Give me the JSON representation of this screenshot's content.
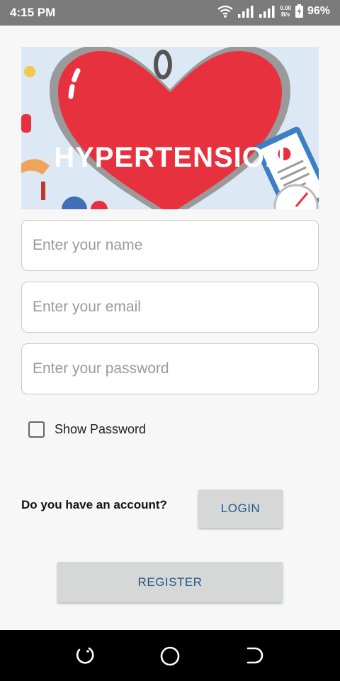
{
  "status_bar": {
    "time": "4:15 PM",
    "net_speed_value": "0.00",
    "net_speed_unit": "B/s",
    "battery": "96%"
  },
  "banner": {
    "title": "HYPERTENSION"
  },
  "form": {
    "name_placeholder": "Enter your name",
    "email_placeholder": "Enter your email",
    "password_placeholder": "Enter your password",
    "show_password_label": "Show Password",
    "show_password_checked": false
  },
  "account": {
    "question": "Do you have an account?",
    "login_label": "LOGIN",
    "register_label": "REGISTER"
  },
  "colors": {
    "status_bar": "#7b7b7b",
    "heart": "#e8313f",
    "button_bg": "#d6d7d7",
    "button_text": "#1e5a8c"
  },
  "nav_bar": {
    "icons": [
      "recent-apps-icon",
      "home-icon",
      "back-icon"
    ]
  }
}
